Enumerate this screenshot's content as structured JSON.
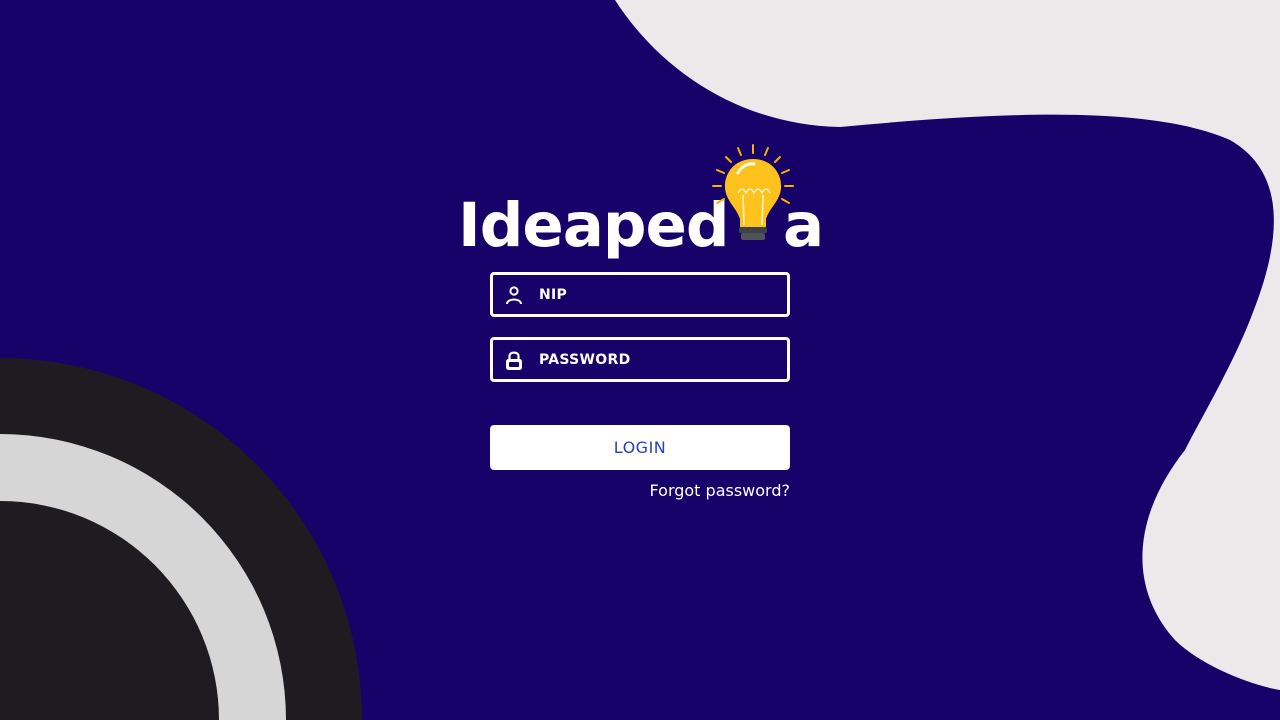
{
  "brand": {
    "logo_text": "Ideaped",
    "logo_tail": "a",
    "logo_icon": "lightbulb-icon"
  },
  "login_form": {
    "nip_placeholder": "NIP",
    "nip_icon": "user-icon",
    "password_placeholder": "PASSWORD",
    "password_icon": "lock-icon",
    "login_label": "LOGIN",
    "forgot_label": "Forgot password?"
  },
  "colors": {
    "background": "#17026a",
    "blob_right": "#ebe9ea",
    "arc_dark": "#1e1c21",
    "arc_light": "#d6d6d6",
    "button_text": "#2a3fb5"
  }
}
